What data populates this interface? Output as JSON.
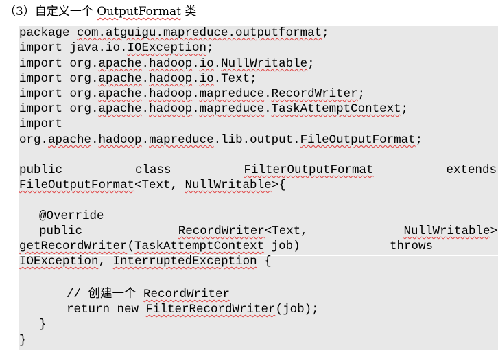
{
  "heading": {
    "number": "（3）",
    "text_before": "自定义一个 ",
    "class_name": "OutputFormat",
    "text_after": " 类"
  },
  "code": {
    "package_kw": "package ",
    "package_name": "com.atguigu.mapreduce.outputformat",
    "package_end": ";",
    "imports": [
      {
        "kw": "import ",
        "a": "java.io.",
        "b": "IOException",
        "c": ";"
      },
      {
        "kw": "import ",
        "a": "org.",
        "b": "apache",
        "c": ".",
        "d": "hadoop",
        "e": ".",
        "f": "io",
        "g": ".",
        "h": "NullWritable",
        "i": ";"
      },
      {
        "kw": "import ",
        "a": "org.",
        "b": "apache",
        "c": ".",
        "d": "hadoop",
        "e": ".",
        "f": "io",
        "g": ".Text;"
      },
      {
        "kw": "import ",
        "a": "org.",
        "b": "apache",
        "c": ".",
        "d": "hadoop",
        "e": ".",
        "f": "mapreduce",
        "g": ".",
        "h": "RecordWriter",
        "i": ";"
      },
      {
        "kw": "import ",
        "a": "org.",
        "b": "apache",
        "c": ".",
        "d": "hadoop",
        "e": ".",
        "f": "mapreduce",
        "g": ".",
        "h": "TaskAttemptContext",
        "i": ";"
      }
    ],
    "import_last_kw": "import",
    "import_last": {
      "a": "org.",
      "b": "apache",
      "c": ".",
      "d": "hadoop",
      "e": ".",
      "f": "mapreduce",
      "g": ".lib.output.",
      "h": "FileOutputFormat",
      "i": ";"
    },
    "class_line": {
      "w1": "public",
      "w2": "class",
      "w3": "FilterOutputFormat",
      "w4": "extends"
    },
    "class_line2": {
      "a": "FileOutputFormat",
      "b": "<Text, ",
      "c": "NullWritable",
      "d": ">{"
    },
    "override": "@Override",
    "method_line": {
      "w1": "public",
      "w2": "RecordWriter",
      "w2b": "<Text,",
      "w3": "NullWritable",
      "w3b": ">"
    },
    "method_line2": {
      "a": "getRecordWriter",
      "b": "(",
      "c": "TaskAttemptContext",
      "d": " job)",
      "e": "throws"
    },
    "method_line3": {
      "a": "IOException",
      "b": ", ",
      "c": "InterruptedException",
      "d": " {"
    },
    "comment": {
      "a": "// 创建一个 ",
      "b": "RecordWriter"
    },
    "return_line": {
      "a": "return new ",
      "b": "FilterRecordWriter",
      "c": "(job);"
    },
    "close_method": "}",
    "close_class": "}"
  }
}
